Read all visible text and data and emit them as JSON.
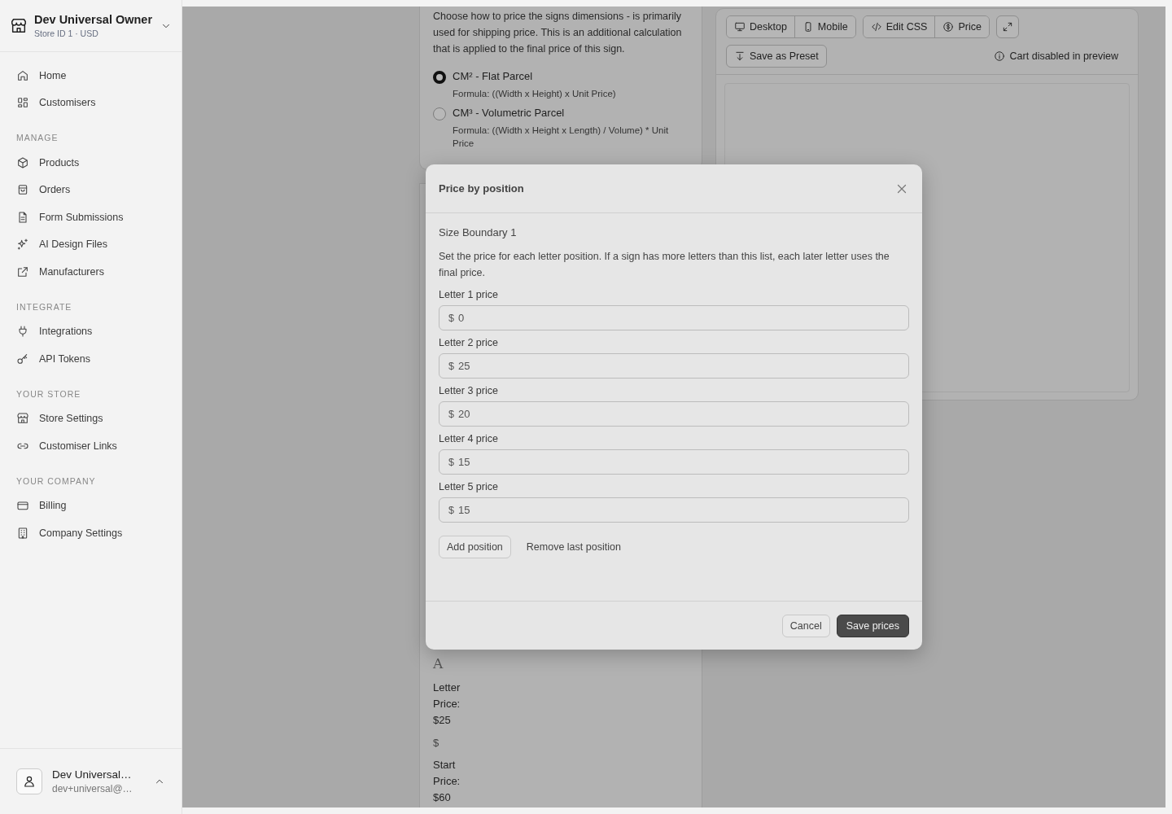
{
  "sidebar": {
    "store": {
      "name": "Dev Universal Owner",
      "subtitle": "Store ID 1 · USD"
    },
    "sections": [
      {
        "items": [
          {
            "label": "Home",
            "selected": false
          },
          {
            "label": "Customisers",
            "selected": false
          }
        ]
      },
      {
        "heading": "MANAGE",
        "items": [
          {
            "label": "Products",
            "selected": false
          },
          {
            "label": "Orders",
            "selected": false
          },
          {
            "label": "Form Submissions",
            "selected": false
          },
          {
            "label": "AI Design Files",
            "selected": false
          },
          {
            "label": "Manufacturers",
            "selected": false
          }
        ]
      },
      {
        "heading": "INTEGRATE",
        "items": [
          {
            "label": "Integrations",
            "selected": false
          },
          {
            "label": "API Tokens",
            "selected": false
          }
        ]
      },
      {
        "heading": "YOUR STORE",
        "items": [
          {
            "label": "Store Settings",
            "selected": false
          },
          {
            "label": "Customiser Links",
            "selected": false
          }
        ]
      },
      {
        "heading": "YOUR COMPANY",
        "items": [
          {
            "label": "Billing",
            "selected": false
          },
          {
            "label": "Company Settings",
            "selected": false
          }
        ]
      }
    ],
    "user": {
      "name": "Dev Universal…",
      "email": "dev+universal@…"
    }
  },
  "panel": {
    "description": "Choose how to price the signs dimensions - is primarily used for shipping price. This is an additional calculation that is applied to the final price of this sign.",
    "options": [
      {
        "label": "CM² - Flat Parcel",
        "formula": "Formula: ((Width x Height) x Unit Price)",
        "selected": true
      },
      {
        "label": "CM³ - Volumetric Parcel",
        "formula": "Formula: ((Width x Height x Length) / Volume) * Unit Price",
        "selected": false
      }
    ],
    "boundary_card": {
      "type_icon": "A",
      "letter_price": "Letter Price: $25",
      "currency": "$",
      "start_price": "Start Price: $60"
    }
  },
  "preview": {
    "view_tabs": [
      "Desktop",
      "Mobile"
    ],
    "tool_tabs": [
      "Edit CSS",
      "Price"
    ],
    "save_preset": "Save as Preset",
    "notice": "Cart disabled in preview"
  },
  "modal": {
    "title": "Price by position",
    "heading": "Size Boundary 1",
    "description": "Set the price for each letter position. If a sign has more letters than this list, each later letter uses the final price.",
    "positions": [
      {
        "label": "Letter 1 price",
        "currency": "$",
        "value": "0"
      },
      {
        "label": "Letter 2 price",
        "currency": "$",
        "value": "25"
      },
      {
        "label": "Letter 3 price",
        "currency": "$",
        "value": "20"
      },
      {
        "label": "Letter 4 price",
        "currency": "$",
        "value": "15"
      },
      {
        "label": "Letter 5 price",
        "currency": "$",
        "value": "15"
      }
    ],
    "add_button": "Add position",
    "remove_button": "Remove last position",
    "cancel": "Cancel",
    "save": "Save prices"
  }
}
